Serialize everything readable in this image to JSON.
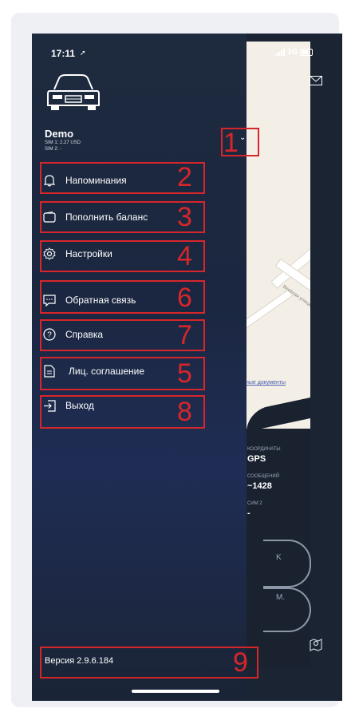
{
  "status_bar": {
    "time": "17:11",
    "network": "3G"
  },
  "user": {
    "name": "Demo",
    "sim1": "SIM 1: 2.27 USD",
    "sim2": "SIM 2: -"
  },
  "menu": {
    "items": [
      {
        "label": "Напоминания",
        "icon": "bell-icon",
        "annotation": "2"
      },
      {
        "label": "Пополнить баланс",
        "icon": "wallet-icon",
        "annotation": "3"
      },
      {
        "label": "Настройки",
        "icon": "gear-icon",
        "annotation": "4"
      },
      {
        "label": "Обратная связь",
        "icon": "chat-icon",
        "annotation": "6"
      },
      {
        "label": "Справка",
        "icon": "help-circle-icon",
        "annotation": "7"
      },
      {
        "label": "Лиц. соглашение",
        "icon": "document-icon",
        "annotation": "5"
      },
      {
        "label": "Выход",
        "icon": "logout-icon",
        "annotation": "8"
      }
    ]
  },
  "account_toggle_annotation": "1",
  "version": {
    "text": "Версия 2.9.6.184",
    "annotation": "9"
  },
  "map_panel": {
    "street": "Весёлая улица",
    "link": "ные документы",
    "stat1_label": "координаты",
    "stat1_value": "GPS",
    "stat2_label": "сообщений",
    "stat2_value": "~1428",
    "stat3_label": "сим 2",
    "stat3_value": "-",
    "dial1_text": "K",
    "dial2_text": "M."
  },
  "colors": {
    "annotation_red": "#d7262b",
    "drawer_bg": "#1e2a3e",
    "map_bg": "#f3efe6"
  }
}
